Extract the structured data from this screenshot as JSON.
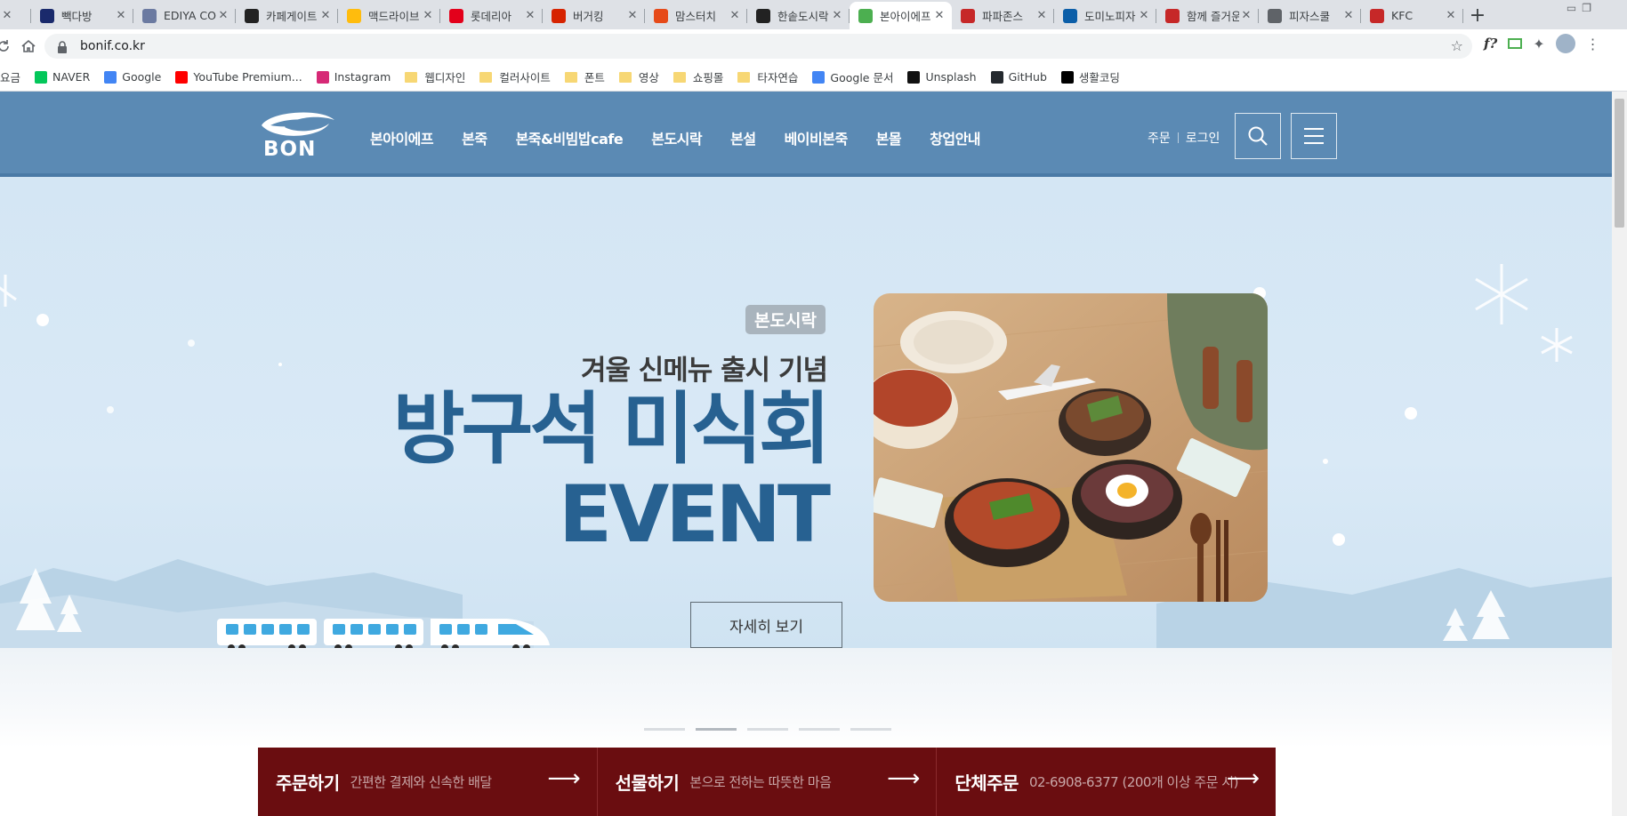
{
  "browser": {
    "tabs": [
      {
        "title": "",
        "favicon": "generic-icon",
        "color": "#9aa0a6"
      },
      {
        "title": "빽다방",
        "favicon": "paikdabang-icon",
        "color": "#1a2a6c"
      },
      {
        "title": "EDIYA CO",
        "favicon": "ediya-icon",
        "color": "#6b7aa1"
      },
      {
        "title": "카페게이트",
        "favicon": "cafegate-icon",
        "color": "#222222"
      },
      {
        "title": "맥드라이브",
        "favicon": "mcdonalds-icon",
        "color": "#ffbc0d"
      },
      {
        "title": "롯데리아",
        "favicon": "lotteria-icon",
        "color": "#e3001b"
      },
      {
        "title": "버거킹",
        "favicon": "burgerking-icon",
        "color": "#d62300"
      },
      {
        "title": "맘스터치",
        "favicon": "momstouch-icon",
        "color": "#e64a19"
      },
      {
        "title": "한솥도시락",
        "favicon": "hansot-icon",
        "color": "#222222"
      },
      {
        "title": "본아이에프",
        "favicon": "bon-icon",
        "color": "#4caf50",
        "active": true
      },
      {
        "title": "파파존스",
        "favicon": "papajohns-icon",
        "color": "#c62828"
      },
      {
        "title": "도미노피자",
        "favicon": "dominos-icon",
        "color": "#0b5ea8"
      },
      {
        "title": "함께 즐거운",
        "favicon": "pizzahut-icon",
        "color": "#c62828"
      },
      {
        "title": "피자스쿨",
        "favicon": "globe-icon",
        "color": "#5f6368"
      },
      {
        "title": "KFC",
        "favicon": "kfc-icon",
        "color": "#c62828"
      }
    ],
    "url": "bonif.co.kr",
    "bookmarks": [
      {
        "label": "요금",
        "type": "link",
        "color": "#5f6368"
      },
      {
        "label": "NAVER",
        "type": "link",
        "color": "#03c75a"
      },
      {
        "label": "Google",
        "type": "link",
        "color": "#4285f4"
      },
      {
        "label": "YouTube Premium...",
        "type": "link",
        "color": "#ff0000"
      },
      {
        "label": "Instagram",
        "type": "link",
        "color": "#d62976"
      },
      {
        "label": "웹디자인",
        "type": "folder"
      },
      {
        "label": "컬러사이트",
        "type": "folder"
      },
      {
        "label": "폰트",
        "type": "folder"
      },
      {
        "label": "영상",
        "type": "folder"
      },
      {
        "label": "쇼핑몰",
        "type": "folder"
      },
      {
        "label": "타자연습",
        "type": "folder"
      },
      {
        "label": "Google 문서",
        "type": "link",
        "color": "#4285f4"
      },
      {
        "label": "Unsplash",
        "type": "link",
        "color": "#111111"
      },
      {
        "label": "GitHub",
        "type": "link",
        "color": "#24292e"
      },
      {
        "label": "생활코딩",
        "type": "link",
        "color": "#000000"
      }
    ]
  },
  "site": {
    "logo_text": "BON",
    "nav": [
      "본아이에프",
      "본죽",
      "본죽&비빔밥cafe",
      "본도시락",
      "본설",
      "베이비본죽",
      "본몰",
      "창업안내"
    ],
    "util": {
      "order": "주문",
      "login": "로그인"
    },
    "hero": {
      "tag": "본도시락",
      "subtitle": "겨울 신메뉴 출시 기념",
      "title_line1": "방구석 미식회",
      "title_line2": "EVENT",
      "button": "자세히 보기",
      "slide_count": 5,
      "active_slide": 2
    },
    "quick_links": [
      {
        "title": "주문하기",
        "desc": "간편한 결제와 신속한 배달",
        "arrow": "⟶"
      },
      {
        "title": "선물하기",
        "desc": "본으로 전하는 따뜻한 마음",
        "arrow": "⟶"
      },
      {
        "title": "단체주문",
        "desc": "02-6908-6377 (200개 이상 주문 시)",
        "arrow": "⟶"
      }
    ],
    "colors": {
      "header": "#5b8ab4",
      "accent_text": "#276191",
      "quick_bar": "#6a0d10"
    }
  }
}
